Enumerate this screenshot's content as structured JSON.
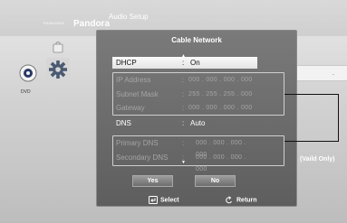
{
  "topbar": {
    "pandora_small": "PANDORA",
    "pandora": "Pandora",
    "section": "Audio Setup"
  },
  "sidebar": {
    "disc_icon": "disc-icon",
    "disc_label": "DVD",
    "settings_icon": "gear-icon",
    "bag_icon": "bag-icon"
  },
  "right_panel": {
    "marker": "."
  },
  "dialog": {
    "title": "Cable Network",
    "rows": [
      {
        "label": "DHCP",
        "value": "On"
      },
      {
        "label": "IP Address",
        "value": "000 . 000 . 000 . 000"
      },
      {
        "label": "Subnet Mask",
        "value": "255 . 255 . 255 . 000"
      },
      {
        "label": "Gateway",
        "value": "000 . 000 . 000 . 000"
      },
      {
        "label": "DNS",
        "value": "Auto"
      },
      {
        "label": "Primary DNS",
        "value": "000 . 000 . 000 . 000"
      },
      {
        "label": "Secondary DNS",
        "value": "000 . 000 . 000 . 000"
      }
    ],
    "colon": ":",
    "up_arrow": "▲",
    "down_arrow": "▼",
    "buttons": {
      "yes": "Yes",
      "no": "No"
    },
    "footer": {
      "select": "Select",
      "return": "Return"
    }
  },
  "callout": {
    "text": "(Vaild Only)"
  },
  "colors": {
    "dialog_bg": "#6a6a6a",
    "highlight": "#f0f0f0",
    "dim_text": "#a4a4a4"
  }
}
